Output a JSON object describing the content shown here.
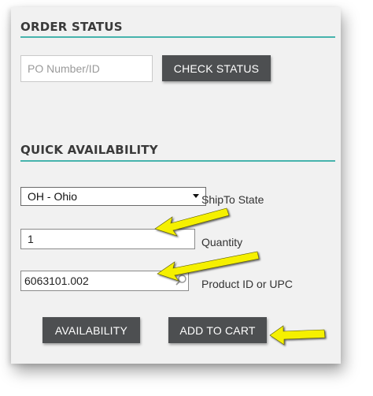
{
  "order_status": {
    "title": "ORDER STATUS",
    "po_placeholder": "PO Number/ID",
    "check_status_label": "CHECK STATUS"
  },
  "quick_availability": {
    "title": "QUICK AVAILABILITY",
    "state_selected": "OH - Ohio",
    "state_label": "ShipTo State",
    "quantity_value": "1",
    "quantity_label": "Quantity",
    "product_value": "6063101.002",
    "product_label": "Product ID or UPC",
    "availability_label": "AVAILABILITY",
    "add_to_cart_label": "ADD TO CART"
  },
  "colors": {
    "accent": "#47b3ad",
    "button": "#4d4f51",
    "panel": "#f1f1f1",
    "annotation_arrow": "#f5f000"
  },
  "icons": [
    "search-icon",
    "caret-down-icon",
    "annotation-arrow-icon"
  ]
}
